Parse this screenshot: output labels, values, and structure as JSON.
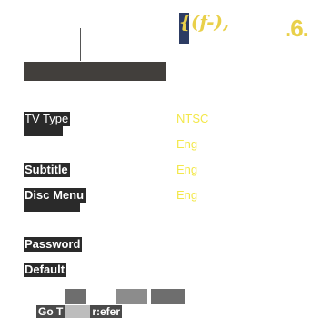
{
  "header": {
    "caption": "",
    "logo_text": "{(f-),",
    "page_number": ".6."
  },
  "menu": {
    "items": [
      {
        "label": "TV Type",
        "value": "NTSC"
      },
      {
        "label": "",
        "value": "Eng"
      },
      {
        "label": "Subtitle",
        "value": "Eng"
      },
      {
        "label": "Disc Menu",
        "value": "Eng"
      },
      {
        "label": "",
        "value": ""
      },
      {
        "label": "Password",
        "value": ""
      },
      {
        "label": "Default",
        "value": ""
      }
    ]
  },
  "footer": {
    "go_prefix": "Go T",
    "go_suffix": "r:efer"
  }
}
